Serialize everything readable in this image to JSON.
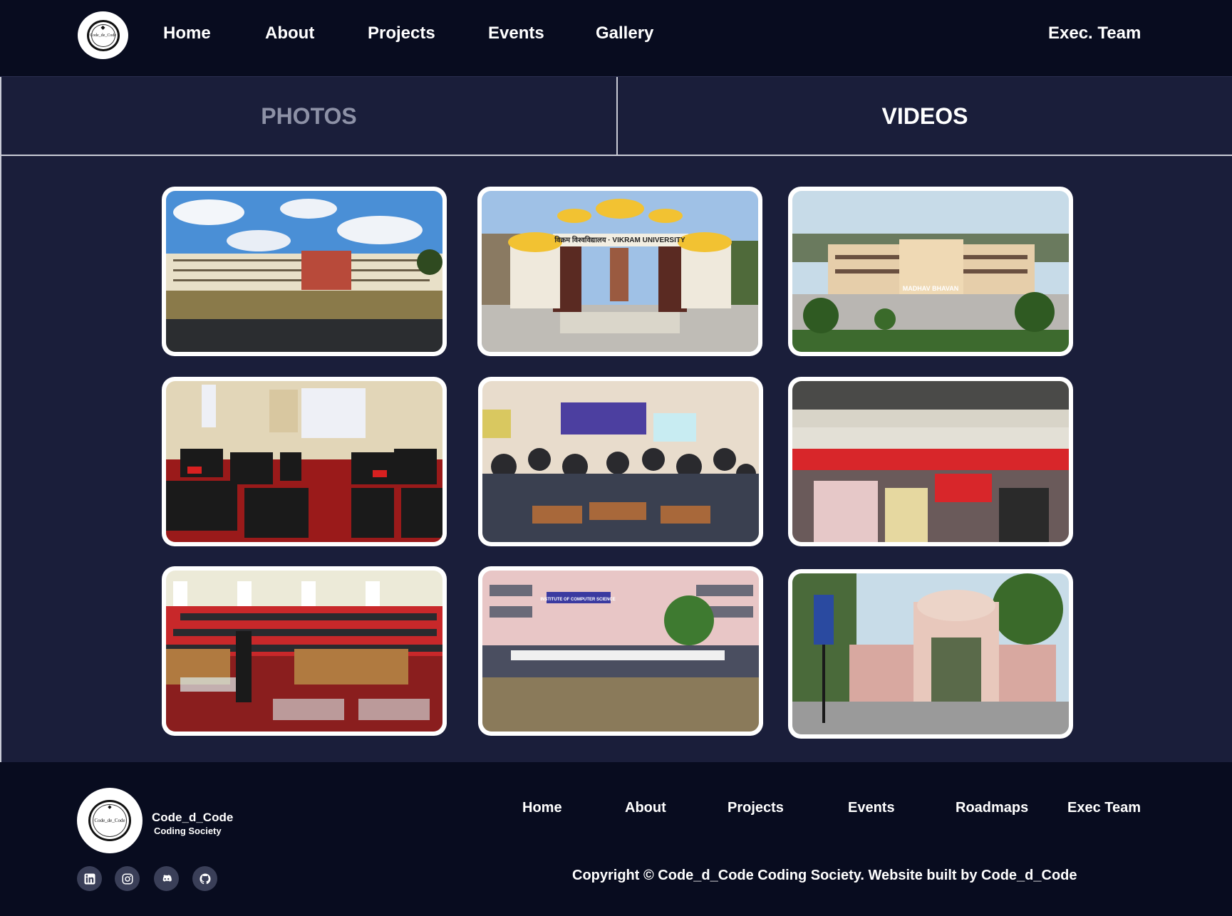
{
  "header": {
    "logo_text": "Code_de_Code",
    "nav": [
      "Home",
      "About",
      "Projects",
      "Events",
      "Gallery"
    ],
    "exec_team": "Exec. Team"
  },
  "tabs": {
    "photos": "PHOTOS",
    "videos": "VIDEOS"
  },
  "gallery": {
    "photo_signs": [
      "",
      "विक्रम विश्वविद्यालय · VIKRAM UNIVERSITY",
      "MADHAV BHAVAN",
      "",
      "",
      "",
      "",
      "INSTITUTE OF COMPUTER SCIENCE",
      ""
    ]
  },
  "footer": {
    "brand_name": "Code_d_Code",
    "brand_sub": "Coding Society",
    "nav": [
      "Home",
      "About",
      "Projects",
      "Events",
      "Roadmaps",
      "Exec Team"
    ],
    "copyright": "Copyright © Code_d_Code  Coding Society. Website built by Code_d_Code",
    "social_icons": [
      "linkedin-icon",
      "instagram-icon",
      "discord-icon",
      "github-icon"
    ]
  },
  "colors": {
    "background": "#080c1f",
    "panel": "#1a1e3a",
    "inactive_tab": "#8d91a6",
    "social_bg": "#3a3f58"
  }
}
